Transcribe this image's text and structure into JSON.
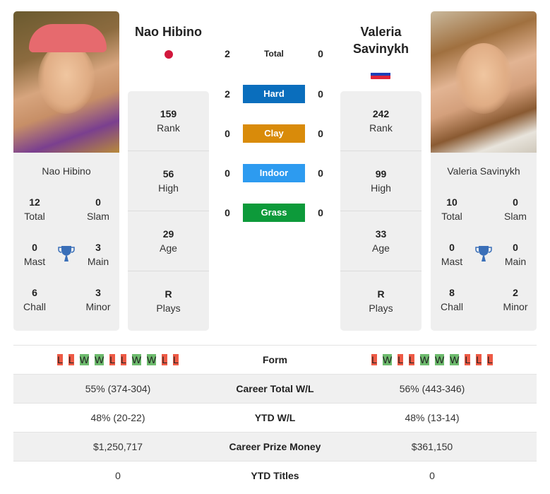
{
  "colors": {
    "hard": "#0a6ebd",
    "clay": "#d98b0a",
    "indoor": "#2d9bf0",
    "grass": "#0d9a3a",
    "win": "#6dbb6d",
    "loss": "#ee5a45",
    "trophy": "#3a6fb8"
  },
  "player_left": {
    "name": "Nao Hibino",
    "flag": "japan-flag",
    "photo": "player-photo",
    "titles": {
      "total": {
        "value": "12",
        "label": "Total"
      },
      "slam": {
        "value": "0",
        "label": "Slam"
      },
      "mast": {
        "value": "0",
        "label": "Mast"
      },
      "main": {
        "value": "3",
        "label": "Main"
      },
      "chall": {
        "value": "6",
        "label": "Chall"
      },
      "minor": {
        "value": "3",
        "label": "Minor"
      }
    },
    "side": [
      {
        "value": "159",
        "label": "Rank"
      },
      {
        "value": "56",
        "label": "High"
      },
      {
        "value": "29",
        "label": "Age"
      },
      {
        "value": "R",
        "label": "Plays"
      }
    ],
    "form": [
      "L",
      "L",
      "W",
      "W",
      "L",
      "L",
      "W",
      "W",
      "L",
      "L"
    ]
  },
  "player_right": {
    "name": "Valeria Savinykh",
    "flag": "russia-flag",
    "photo": "player-photo",
    "titles": {
      "total": {
        "value": "10",
        "label": "Total"
      },
      "slam": {
        "value": "0",
        "label": "Slam"
      },
      "mast": {
        "value": "0",
        "label": "Mast"
      },
      "main": {
        "value": "0",
        "label": "Main"
      },
      "chall": {
        "value": "8",
        "label": "Chall"
      },
      "minor": {
        "value": "2",
        "label": "Minor"
      }
    },
    "side": [
      {
        "value": "242",
        "label": "Rank"
      },
      {
        "value": "99",
        "label": "High"
      },
      {
        "value": "33",
        "label": "Age"
      },
      {
        "value": "R",
        "label": "Plays"
      }
    ],
    "form": [
      "L",
      "W",
      "L",
      "L",
      "W",
      "W",
      "W",
      "L",
      "L",
      "L"
    ]
  },
  "h2h": [
    {
      "label": "Total",
      "left": "2",
      "right": "0",
      "color": ""
    },
    {
      "label": "Hard",
      "left": "2",
      "right": "0",
      "color": "#0a6ebd"
    },
    {
      "label": "Clay",
      "left": "0",
      "right": "0",
      "color": "#d98b0a"
    },
    {
      "label": "Indoor",
      "left": "0",
      "right": "0",
      "color": "#2d9bf0"
    },
    {
      "label": "Grass",
      "left": "0",
      "right": "0",
      "color": "#0d9a3a"
    }
  ],
  "table": {
    "form_label": "Form",
    "rows": [
      {
        "label": "Career Total W/L",
        "left": "55% (374-304)",
        "right": "56% (443-346)"
      },
      {
        "label": "YTD W/L",
        "left": "48% (20-22)",
        "right": "48% (13-14)"
      },
      {
        "label": "Career Prize Money",
        "left": "$1,250,717",
        "right": "$361,150"
      },
      {
        "label": "YTD Titles",
        "left": "0",
        "right": "0"
      }
    ]
  }
}
